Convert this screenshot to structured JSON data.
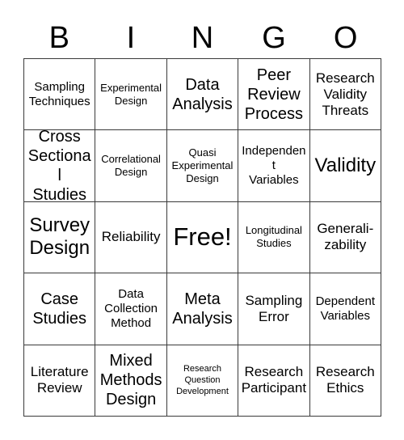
{
  "card": {
    "header_letters": [
      "B",
      "I",
      "N",
      "G",
      "O"
    ],
    "columns": 5,
    "rows": 5,
    "free_space_label": "Free!",
    "free_space_position": {
      "row": 3,
      "column": 3
    },
    "border_color": "#3a3a3a",
    "background_color": "#ffffff",
    "text_color": "#000000",
    "cells": [
      {
        "text": "Sampling\nTechniques",
        "size": "md"
      },
      {
        "text": "Experimental\nDesign",
        "size": "sm"
      },
      {
        "text": "Data\nAnalysis",
        "size": "xl"
      },
      {
        "text": "Peer\nReview\nProcess",
        "size": "xl"
      },
      {
        "text": "Research\nValidity\nThreats",
        "size": "lg"
      },
      {
        "text": "Cross\nSectional\nStudies",
        "size": "xl"
      },
      {
        "text": "Correlational\nDesign",
        "size": "sm"
      },
      {
        "text": "Quasi\nExperimental\nDesign",
        "size": "sm"
      },
      {
        "text": "Independent\nVariables",
        "size": "md"
      },
      {
        "text": "Validity",
        "size": "xxl"
      },
      {
        "text": "Survey\nDesign",
        "size": "xxl"
      },
      {
        "text": "Reliability",
        "size": "lg"
      },
      {
        "text": "Free!",
        "size": "free"
      },
      {
        "text": "Longitudinal\nStudies",
        "size": "sm"
      },
      {
        "text": "Generali-\nzability",
        "size": "lg"
      },
      {
        "text": "Case\nStudies",
        "size": "xl"
      },
      {
        "text": "Data\nCollection\nMethod",
        "size": "md"
      },
      {
        "text": "Meta\nAnalysis",
        "size": "xl"
      },
      {
        "text": "Sampling\nError",
        "size": "lg"
      },
      {
        "text": "Dependent\nVariables",
        "size": "md"
      },
      {
        "text": "Literature\nReview",
        "size": "lg"
      },
      {
        "text": "Mixed\nMethods\nDesign",
        "size": "xl"
      },
      {
        "text": "Research\nQuestion\nDevelopment",
        "size": "xs"
      },
      {
        "text": "Research\nParticipant",
        "size": "lg"
      },
      {
        "text": "Research\nEthics",
        "size": "lg"
      }
    ]
  }
}
